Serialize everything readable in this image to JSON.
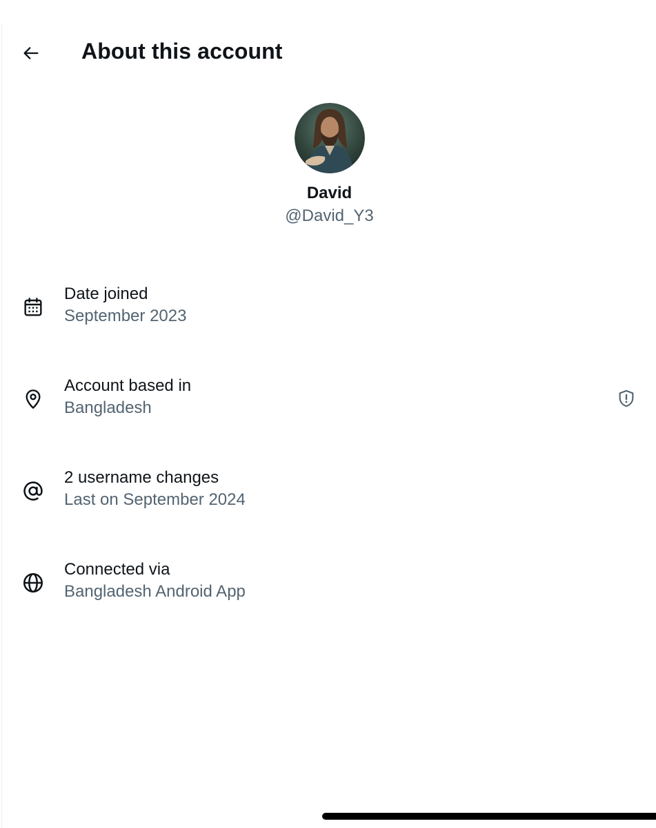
{
  "header": {
    "title": "About this account",
    "back_icon": "arrow-left-icon"
  },
  "profile": {
    "display_name": "David",
    "handle": "@David_Y3",
    "avatar_icon": "profile-photo"
  },
  "details": [
    {
      "icon": "calendar-icon",
      "label": "Date joined",
      "value": "September 2023"
    },
    {
      "icon": "location-pin-icon",
      "label": "Account based in",
      "value": "Bangladesh",
      "trailing_icon": "shield-alert-icon"
    },
    {
      "icon": "at-sign-icon",
      "label": "2 username changes",
      "value": "Last on September 2024"
    },
    {
      "icon": "globe-icon",
      "label": "Connected via",
      "value": "Bangladesh Android App"
    }
  ],
  "colors": {
    "primary_text": "#0f1419",
    "secondary_text": "#536471",
    "background": "#ffffff"
  }
}
